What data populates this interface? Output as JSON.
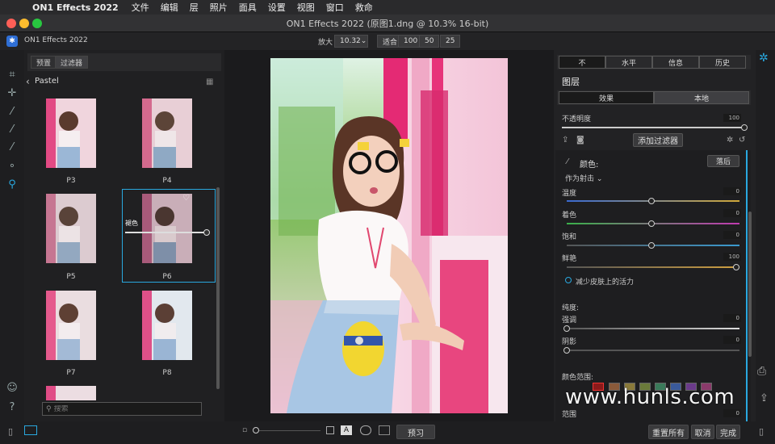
{
  "menubar": {
    "app_name": "ON1 Effects 2022",
    "items": [
      "文件",
      "编辑",
      "层",
      "照片",
      "面具",
      "设置",
      "视图",
      "窗口",
      "救命"
    ]
  },
  "window": {
    "title": "ON1 Effects 2022 (原图1.dng @ 10.3% 16-bit)",
    "app_label": "ON1 Effects 2022"
  },
  "zoom": {
    "label": "放大",
    "value": "10.32",
    "fit": "适合",
    "presets": [
      "100",
      "50",
      "25"
    ]
  },
  "browser": {
    "tabs": [
      "预置",
      "过滤器"
    ],
    "category": "Pastel",
    "presets": [
      "P3",
      "P4",
      "P5",
      "P6",
      "P7",
      "P8"
    ],
    "hover_label": "褪色",
    "search_placeholder": "搜索"
  },
  "panel": {
    "top_tabs": [
      "不",
      "水平",
      "信息",
      "历史"
    ],
    "section_title": "图层",
    "mode_tabs": [
      "效果",
      "本地"
    ],
    "opacity_label": "不透明度",
    "opacity_value": "100",
    "add_filter": "添加过滤器",
    "filter_name": "颜色:",
    "filter_button": "落后",
    "apply_mode": "作为射击 ⌄",
    "sliders": [
      {
        "label": "温度",
        "value": "0"
      },
      {
        "label": "着色",
        "value": "0"
      },
      {
        "label": "饱和",
        "value": "0"
      },
      {
        "label": "鲜艳",
        "value": "100"
      }
    ],
    "skin_option": "减少皮肤上的活力",
    "purity_title": "纯度:",
    "purity_sliders": [
      {
        "label": "强调",
        "value": "0"
      },
      {
        "label": "阴影",
        "value": "0"
      }
    ],
    "color_range_title": "颜色范围:",
    "range_label": "范围",
    "range_value": "0",
    "swatch_colors": [
      "#8b1a1a",
      "#8a5a3a",
      "#8a7a3a",
      "#6a7a3a",
      "#3a7a5a",
      "#3a5a9a",
      "#6a3a8a",
      "#8a3a6a"
    ]
  },
  "bottom": {
    "preview": "预习",
    "reset_all": "重置所有",
    "cancel": "取消",
    "done": "完成"
  },
  "watermark": "www.hunls.com",
  "colors": {
    "accent": "#29a8df",
    "background": "#1b1b1d"
  }
}
